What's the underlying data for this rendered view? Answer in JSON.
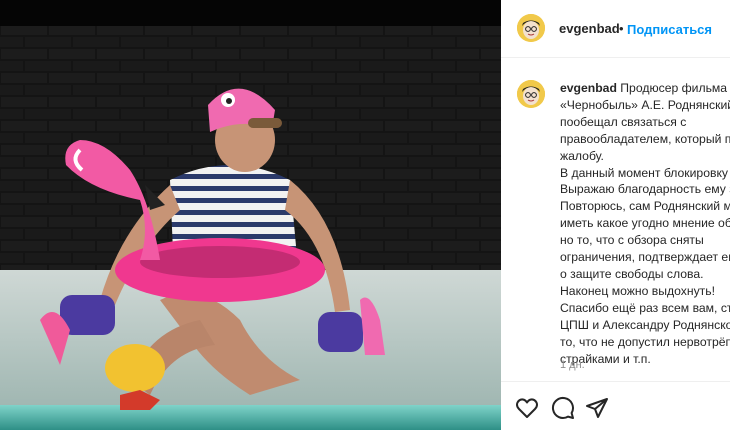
{
  "header": {
    "username": "evgenbad",
    "separator": "•",
    "follow_label": "Подписаться"
  },
  "caption": {
    "username": "evgenbad",
    "text": "Продюсер фильма «Чернобыль» А.Е. Роднянский пообещал связаться с правообладателем, который подал жалобу.\nВ данный момент блокировку сняли. Выражаю благодарность ему за это. Повторюсь, сам Роднянский может иметь какое угодно мнение обо мне, но то, что с обзора сняты ограничения, подтверждает его идеи о защите свободы слова.\nНаконец можно выдохнуть!\nСпасибо ещё раз всем вам, студии ЦПШ и Александру Роднянскому за то, что не допустил нервотрёпки со страйками и т.п.",
    "time": "1 дн."
  },
  "actions": {
    "like_icon": "heart-icon",
    "comment_icon": "comment-icon",
    "share_icon": "paper-plane-icon"
  },
  "colors": {
    "link": "#0095f6",
    "text": "#262626",
    "muted": "#8e8e8e",
    "avatar_bg": "#f1c94a",
    "flamingo": "#f0388f"
  }
}
